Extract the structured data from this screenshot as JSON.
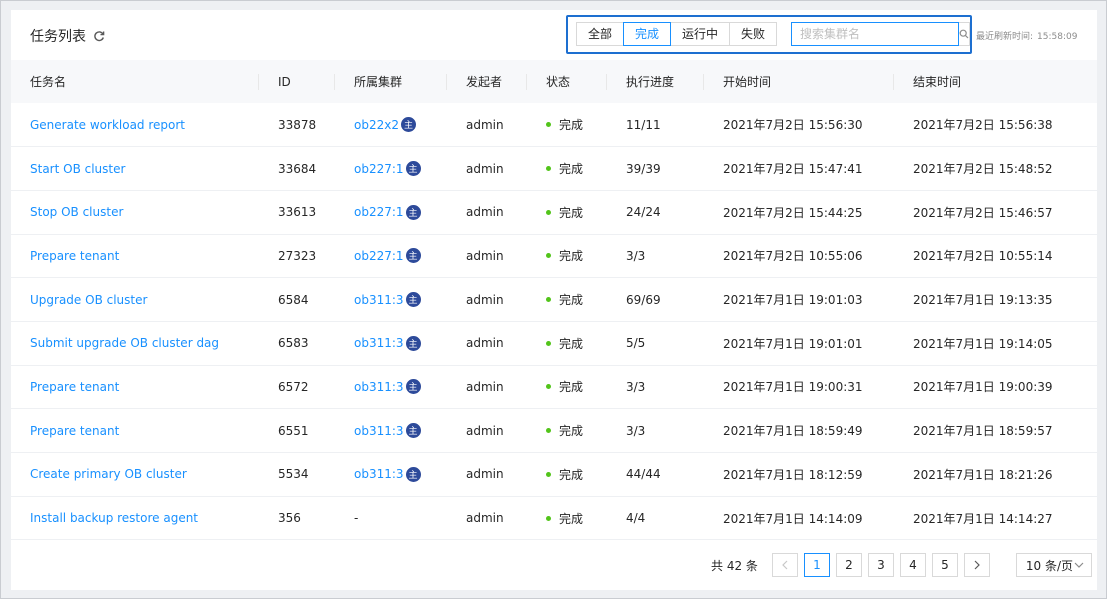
{
  "header": {
    "title": "任务列表",
    "filters": [
      "全部",
      "完成",
      "运行中",
      "失败"
    ],
    "active_filter_index": 1,
    "search_placeholder": "搜索集群名",
    "last_refresh_label": "最近刷新时间:",
    "last_refresh_time": "15:58:09"
  },
  "columns": [
    "任务名",
    "ID",
    "所属集群",
    "发起者",
    "状态",
    "执行进度",
    "开始时间",
    "结束时间"
  ],
  "cluster_badge": "主",
  "rows": [
    {
      "name": "Generate workload report",
      "id": "33878",
      "cluster": "ob22x2",
      "has_badge": true,
      "initiator": "admin",
      "status": "完成",
      "progress": "11/11",
      "start": "2021年7月2日 15:56:30",
      "end": "2021年7月2日 15:56:38"
    },
    {
      "name": "Start OB cluster",
      "id": "33684",
      "cluster": "ob227:1",
      "has_badge": true,
      "initiator": "admin",
      "status": "完成",
      "progress": "39/39",
      "start": "2021年7月2日 15:47:41",
      "end": "2021年7月2日 15:48:52"
    },
    {
      "name": "Stop OB cluster",
      "id": "33613",
      "cluster": "ob227:1",
      "has_badge": true,
      "initiator": "admin",
      "status": "完成",
      "progress": "24/24",
      "start": "2021年7月2日 15:44:25",
      "end": "2021年7月2日 15:46:57"
    },
    {
      "name": "Prepare tenant",
      "id": "27323",
      "cluster": "ob227:1",
      "has_badge": true,
      "initiator": "admin",
      "status": "完成",
      "progress": "3/3",
      "start": "2021年7月2日 10:55:06",
      "end": "2021年7月2日 10:55:14"
    },
    {
      "name": "Upgrade OB cluster",
      "id": "6584",
      "cluster": "ob311:3",
      "has_badge": true,
      "initiator": "admin",
      "status": "完成",
      "progress": "69/69",
      "start": "2021年7月1日 19:01:03",
      "end": "2021年7月1日 19:13:35"
    },
    {
      "name": "Submit upgrade OB cluster dag",
      "id": "6583",
      "cluster": "ob311:3",
      "has_badge": true,
      "initiator": "admin",
      "status": "完成",
      "progress": "5/5",
      "start": "2021年7月1日 19:01:01",
      "end": "2021年7月1日 19:14:05"
    },
    {
      "name": "Prepare tenant",
      "id": "6572",
      "cluster": "ob311:3",
      "has_badge": true,
      "initiator": "admin",
      "status": "完成",
      "progress": "3/3",
      "start": "2021年7月1日 19:00:31",
      "end": "2021年7月1日 19:00:39"
    },
    {
      "name": "Prepare tenant",
      "id": "6551",
      "cluster": "ob311:3",
      "has_badge": true,
      "initiator": "admin",
      "status": "完成",
      "progress": "3/3",
      "start": "2021年7月1日 18:59:49",
      "end": "2021年7月1日 18:59:57"
    },
    {
      "name": "Create primary OB cluster",
      "id": "5534",
      "cluster": "ob311:3",
      "has_badge": true,
      "initiator": "admin",
      "status": "完成",
      "progress": "44/44",
      "start": "2021年7月1日 18:12:59",
      "end": "2021年7月1日 18:21:26"
    },
    {
      "name": "Install backup restore agent",
      "id": "356",
      "cluster": "-",
      "has_badge": false,
      "initiator": "admin",
      "status": "完成",
      "progress": "4/4",
      "start": "2021年7月1日 14:14:09",
      "end": "2021年7月1日 14:14:27"
    }
  ],
  "pagination": {
    "total_label": "共 42 条",
    "pages": [
      "1",
      "2",
      "3",
      "4",
      "5"
    ],
    "current_page": "1",
    "prev": "<",
    "next": ">",
    "page_size": "10 条/页"
  },
  "colors": {
    "accent": "#1890ff",
    "highlight_box": "#1d6fd0",
    "status_done": "#52c41a",
    "badge": "#2d4a9a"
  }
}
